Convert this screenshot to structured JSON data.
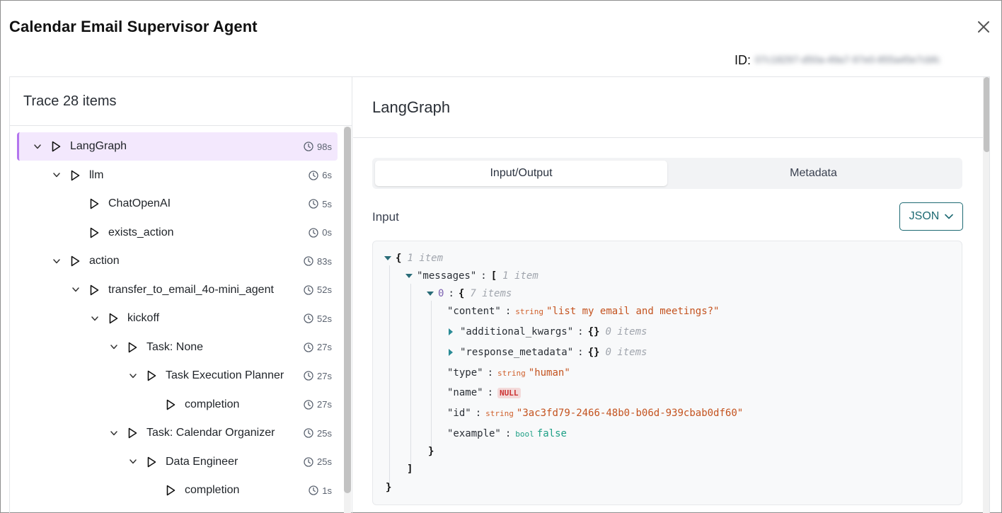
{
  "header": {
    "title": "Calendar Email Supervisor Agent",
    "id_label": "ID:",
    "id_value": "07c18297-d50a-49a7-97e0-855a45e7cbfc"
  },
  "trace": {
    "title": "Trace 28 items",
    "items": [
      {
        "label": "LangGraph",
        "duration": "98s",
        "depth": 0,
        "expanded": true,
        "selected": true
      },
      {
        "label": "llm",
        "duration": "6s",
        "depth": 1,
        "expanded": true
      },
      {
        "label": "ChatOpenAI",
        "duration": "5s",
        "depth": 2,
        "leaf": true
      },
      {
        "label": "exists_action",
        "duration": "0s",
        "depth": 2,
        "leaf": true
      },
      {
        "label": "action",
        "duration": "83s",
        "depth": 1,
        "expanded": true
      },
      {
        "label": "transfer_to_email_4o-mini_agent",
        "duration": "52s",
        "depth": 2,
        "expanded": true
      },
      {
        "label": "kickoff",
        "duration": "52s",
        "depth": 3,
        "expanded": true
      },
      {
        "label": "Task: None",
        "duration": "27s",
        "depth": 4,
        "expanded": true
      },
      {
        "label": "Task Execution Planner",
        "duration": "27s",
        "depth": 5,
        "expanded": true
      },
      {
        "label": "completion",
        "duration": "27s",
        "depth": 6,
        "leaf": true
      },
      {
        "label": "Task: Calendar Organizer",
        "duration": "25s",
        "depth": 4,
        "expanded": true
      },
      {
        "label": "Data Engineer",
        "duration": "25s",
        "depth": 5,
        "expanded": true
      },
      {
        "label": "completion",
        "duration": "1s",
        "depth": 6,
        "leaf": true
      }
    ]
  },
  "detail": {
    "title": "LangGraph",
    "tabs": {
      "input_output": "Input/Output",
      "metadata": "Metadata"
    },
    "input_label": "Input",
    "format_button": "JSON",
    "json": {
      "root_open": "{",
      "root_meta": "1 item",
      "messages_key": "\"messages\"",
      "messages_open": "[",
      "messages_meta": "1 item",
      "idx_key": "0",
      "idx_open": "{",
      "idx_meta": "7 items",
      "content_key": "\"content\"",
      "content_type": "string",
      "content_val": "\"list my email and meetings?\"",
      "ak_key": "\"additional_kwargs\"",
      "ak_val": "{}",
      "ak_meta": "0 items",
      "rm_key": "\"response_metadata\"",
      "rm_val": "{}",
      "rm_meta": "0 items",
      "type_key": "\"type\"",
      "type_type": "string",
      "type_val": "\"human\"",
      "name_key": "\"name\"",
      "name_val": "NULL",
      "id_key": "\"id\"",
      "id_type": "string",
      "id_val": "\"3ac3fd79-2466-48b0-b06d-939cbab0df60\"",
      "example_key": "\"example\"",
      "example_type": "bool",
      "example_val": "false",
      "close_obj": "}",
      "close_arr": "]",
      "close_root": "}",
      "colon": ":"
    }
  },
  "colors": {
    "accent": "#b476ee",
    "selected_bg": "#f3e8fd",
    "teal": "#1e6a73"
  }
}
